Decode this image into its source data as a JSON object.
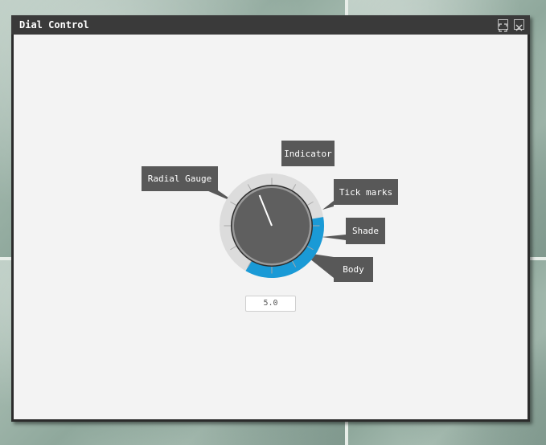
{
  "window": {
    "title": "Dial Control"
  },
  "dial": {
    "value": 5.0,
    "display_value": "5.0",
    "gauge_fill_fraction": 0.36,
    "colors": {
      "gauge_fill": "#1a9ad6",
      "gauge_track": "#dcdcdc",
      "body": "#5f5f5f",
      "body_rim": "#9a9a9a",
      "indicator": "#ffffff",
      "callout_bg": "#585858"
    }
  },
  "callouts": {
    "indicator": "Indicator",
    "radial_gauge": "Radial Gauge",
    "tick_marks": "Tick marks",
    "shade": "Shade",
    "body": "Body"
  },
  "icons": {
    "maximize": "maximize-icon",
    "close": "close-icon"
  }
}
